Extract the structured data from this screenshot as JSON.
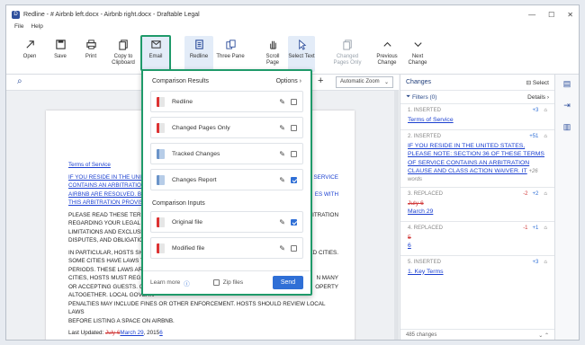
{
  "titlebar": {
    "title": "Redline - # Airbnb left.docx - Airbnb right.docx - Draftable Legal"
  },
  "menu": [
    "File",
    "Help"
  ],
  "ribbon": [
    {
      "label": "Open",
      "icon": "open-icon"
    },
    {
      "label": "Save",
      "icon": "save-icon"
    },
    {
      "label": "Print",
      "icon": "print-icon"
    },
    {
      "label": "Copy to Clipboard",
      "icon": "copy-icon"
    },
    {
      "label": "Email",
      "icon": "email-icon"
    },
    {
      "label": "Redline",
      "icon": "redline-icon"
    },
    {
      "label": "Three Pane",
      "icon": "three-pane-icon"
    },
    {
      "label": "Scroll Page",
      "icon": "hand-icon"
    },
    {
      "label": "Select Text",
      "icon": "cursor-icon"
    },
    {
      "label": "Changed Pages Only",
      "icon": "changed-pages-icon"
    },
    {
      "label": "Previous Change",
      "icon": "up-icon"
    },
    {
      "label": "Next Change",
      "icon": "down-icon"
    }
  ],
  "zoom": {
    "value": "Automatic Zoom"
  },
  "doc": {
    "tos": "Terms of Service",
    "p1": "IF YOU RESIDE IN THE UNITED",
    "p1b": "CONTAINS AN ARBITRATION",
    "p1c": "AIRBNB ARE RESOLVED. BY A",
    "p1d": "THIS ARBITRATION PROVISIO",
    "p2": "PLEASE READ THESE TERMS O",
    "p2b": "REGARDING YOUR LEGAL RIG",
    "p2c": "LIMITATIONS AND EXCLUSIO",
    "p2d": "DISPUTES, AND OBLIGATIONS",
    "p3": "IN PARTICULAR, HOSTS SHOUL",
    "p3b": "SOME CITIES HAVE LAWS THA",
    "p3c": "PERIODS. THESE LAWS ARE O",
    "p3d": "CITIES, HOSTS MUST REGISTE",
    "p3e": "OR ACCEPTING GUESTS. CERT",
    "p3f": "ALTOGETHER. LOCAL GOVERN",
    "p3g": "PENALTIES MAY INCLUDE FINES OR OTHER ENFORCEMENT. HOSTS SHOULD REVIEW LOCAL LAWS",
    "p3h": "BEFORE LISTING A SPACE ON AIRBNB.",
    "r1": "SERVICE",
    "r2": "ES WITH",
    "r3": "ARBITRATION",
    "r4": "ED CITIES.",
    "r5": "N MANY",
    "r6": "OPERTY",
    "updated": "Last Updated: ",
    "old": "July 6",
    "new": "March 29",
    "year": ", 2015",
    "six": "6"
  },
  "panel": {
    "results_heading": "Comparison Results",
    "options": "Options",
    "items": [
      {
        "label": "Redline",
        "kind": "pdf",
        "checked": false
      },
      {
        "label": "Changed Pages Only",
        "kind": "pdf",
        "checked": false
      },
      {
        "label": "Tracked Changes",
        "kind": "doc",
        "checked": false
      },
      {
        "label": "Changes Report",
        "kind": "doc",
        "checked": true
      }
    ],
    "inputs_heading": "Comparison Inputs",
    "inputs": [
      {
        "label": "Original file",
        "kind": "pdf",
        "checked": true
      },
      {
        "label": "Modified file",
        "kind": "pdf",
        "checked": false
      }
    ],
    "learn": "Learn more",
    "zip": "Zip files",
    "send": "Send"
  },
  "changes": {
    "title": "Changes",
    "select": "Select",
    "filters": "Filters (0)",
    "details": "Details",
    "items": [
      {
        "head": "1. INSERTED",
        "count": "+3",
        "text": "Terms of Service"
      },
      {
        "head": "2. INSERTED",
        "count": "+51",
        "text": "IF YOU RESIDE IN THE UNITED STATES, PLEASE NOTE: SECTION 36 OF THESE TERMS OF SERVICE CONTAINS AN ARBITRATION CLAUSE AND CLASS ACTION WAIVER. IT",
        "more": "+26 words"
      },
      {
        "head": "3. REPLACED",
        "minus": "-2",
        "plus": "+2",
        "old": "July 6",
        "new": "March 29"
      },
      {
        "head": "4. REPLACED",
        "minus": "-1",
        "plus": "+1",
        "old": "5",
        "new": "6"
      },
      {
        "head": "5. INSERTED",
        "count": "+3",
        "text": "1. Key Terms"
      }
    ],
    "footer": "485 changes"
  }
}
